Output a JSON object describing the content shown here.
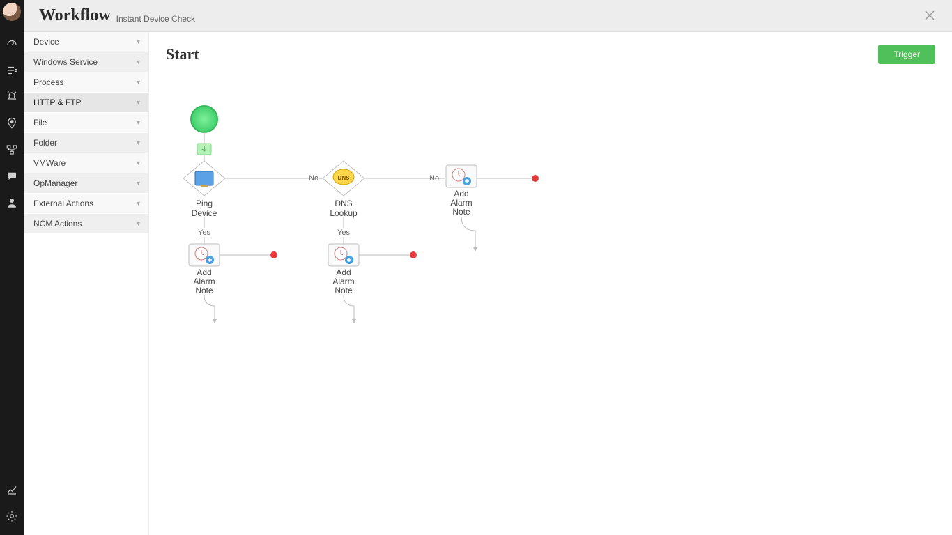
{
  "header": {
    "title": "Workflow",
    "subtitle": "Instant Device Check"
  },
  "sidebar": {
    "items": [
      {
        "label": "Device"
      },
      {
        "label": "Windows Service"
      },
      {
        "label": "Process"
      },
      {
        "label": "HTTP & FTP"
      },
      {
        "label": "File"
      },
      {
        "label": "Folder"
      },
      {
        "label": "VMWare"
      },
      {
        "label": "OpManager"
      },
      {
        "label": "External Actions"
      },
      {
        "label": "NCM Actions"
      }
    ],
    "selected_index": 3
  },
  "canvas": {
    "heading": "Start",
    "trigger_button": "Trigger",
    "edges": {
      "yes": "Yes",
      "no": "No"
    },
    "nodes": {
      "ping": {
        "line1": "Ping",
        "line2": "Device"
      },
      "dns": {
        "line1": "DNS",
        "line2": "Lookup"
      },
      "note1": {
        "line1": "Add",
        "line2": "Alarm",
        "line3": "Note"
      },
      "note2": {
        "line1": "Add",
        "line2": "Alarm",
        "line3": "Note"
      },
      "note3": {
        "line1": "Add",
        "line2": "Alarm",
        "line3": "Note"
      }
    }
  },
  "icons": {
    "dns_badge": "DNS"
  }
}
